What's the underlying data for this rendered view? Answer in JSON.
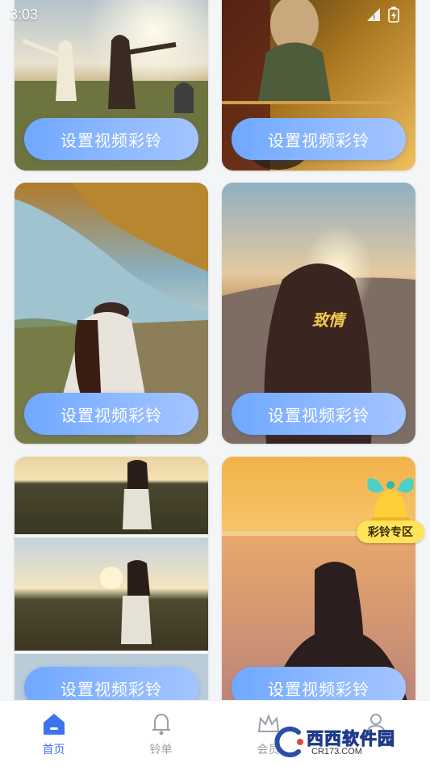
{
  "status_bar": {
    "time": "3:03"
  },
  "cards": [
    {
      "button_label": "设置视频彩铃"
    },
    {
      "button_label": "设置视频彩铃"
    },
    {
      "button_label": "设置视频彩铃"
    },
    {
      "button_label": "设置视频彩铃"
    },
    {
      "button_label": "设置视频彩铃"
    },
    {
      "button_label": "设置视频彩铃"
    }
  ],
  "overlay_texts": {
    "card4_title": "致情"
  },
  "floating_badge": {
    "label": "彩铃专区"
  },
  "tabbar": {
    "items": [
      {
        "label": "首页",
        "icon": "home-icon",
        "active": true
      },
      {
        "label": "铃单",
        "icon": "bell-icon",
        "active": false
      },
      {
        "label": "会员",
        "icon": "crown-icon",
        "active": false
      },
      {
        "label": "",
        "icon": "profile-icon",
        "active": false
      }
    ]
  },
  "watermark": {
    "main": "西西软件园",
    "url": "CR173.COM"
  },
  "colors": {
    "accent": "#3d73f0",
    "button_gradient_start": "#6fa8ff",
    "button_gradient_end": "#a3c4ff",
    "badge": "#ffe45a"
  }
}
